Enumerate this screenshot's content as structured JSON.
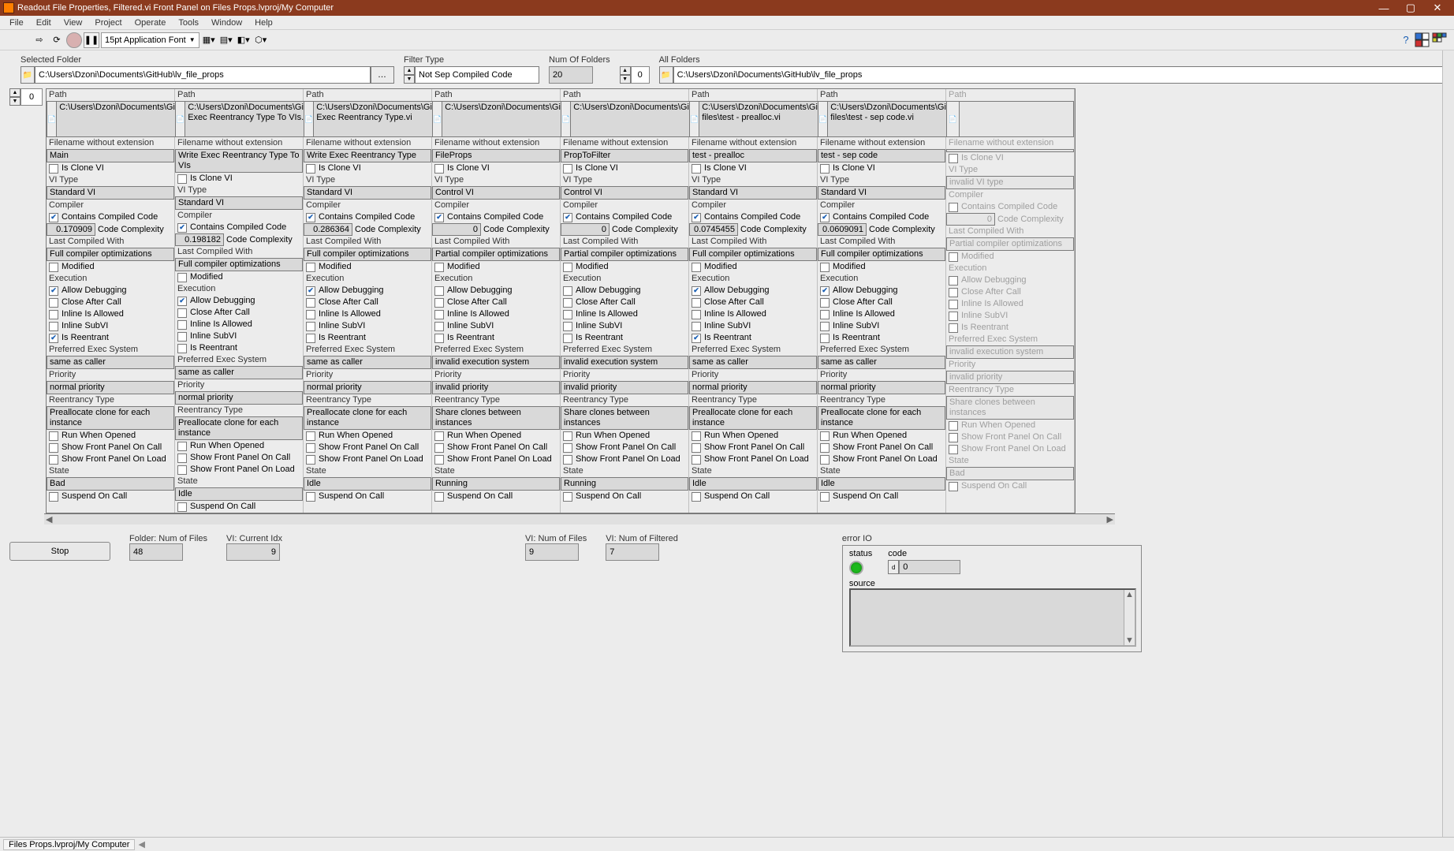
{
  "window": {
    "title": "Readout File Properties, Filtered.vi Front Panel on Files Props.lvproj/My Computer"
  },
  "menu": [
    "File",
    "Edit",
    "View",
    "Project",
    "Operate",
    "Tools",
    "Window",
    "Help"
  ],
  "toolbar": {
    "font": "15pt Application Font"
  },
  "top": {
    "selectedFolder_label": "Selected Folder",
    "selectedFolder": "C:\\Users\\Dzoni\\Documents\\GitHub\\lv_file_props",
    "filterType_label": "Filter Type",
    "filterType": "Not Sep Compiled Code",
    "numFolders_label": "Num Of Folders",
    "numFolders": "20",
    "allFolders_idx": "0",
    "allFolders_label": "All Folders",
    "allFolders": "C:\\Users\\Dzoni\\Documents\\GitHub\\lv_file_props"
  },
  "arrayIndex": "0",
  "labels": {
    "path": "Path",
    "fne": "Filename without extension",
    "isClone": "Is Clone VI",
    "viType": "VI Type",
    "compiler": "Compiler",
    "ccc": "Contains Compiled Code",
    "cc": "Code Complexity",
    "lcw": "Last Compiled With",
    "modified": "Modified",
    "execution": "Execution",
    "allowDebug": "Allow Debugging",
    "closeAfter": "Close After Call",
    "inlineAllowed": "Inline Is Allowed",
    "inlineSub": "Inline SubVI",
    "isReentrant": "Is Reentrant",
    "pes": "Preferred Exec System",
    "priority": "Priority",
    "reentType": "Reentrancy Type",
    "rwo": "Run When Opened",
    "sfpoc": "Show Front Panel On Call",
    "sfpol": "Show Front Panel On Load",
    "state": "State",
    "soc": "Suspend On Call"
  },
  "clusters": [
    {
      "path": "C:\\Users\\Dzoni\\Documents\\GitHub\\lv_file_props\\Main.vi",
      "fne": "Main",
      "isClone": false,
      "viType": "Standard VI",
      "ccc": true,
      "cc": "0.170909",
      "lcw": "Full compiler optimizations",
      "modified": false,
      "allowDebug": true,
      "closeAfter": false,
      "inlineAllowed": false,
      "inlineSub": false,
      "isReentrant": true,
      "pes": "same as caller",
      "priority": "normal priority",
      "reent": "Preallocate clone for each instance",
      "rwo": false,
      "sfpoc": false,
      "sfpol": false,
      "state": "Bad",
      "soc": false
    },
    {
      "path": "C:\\Users\\Dzoni\\Documents\\GitHub\\lv_file_props\\Write Exec Reentrancy Type To VIs.vi",
      "fne": "Write Exec Reentrancy Type To VIs",
      "isClone": false,
      "viType": "Standard VI",
      "ccc": true,
      "cc": "0.198182",
      "lcw": "Full compiler optimizations",
      "modified": false,
      "allowDebug": true,
      "closeAfter": false,
      "inlineAllowed": false,
      "inlineSub": false,
      "isReentrant": false,
      "pes": "same as caller",
      "priority": "normal priority",
      "reent": "Preallocate clone for each instance",
      "rwo": false,
      "sfpoc": false,
      "sfpol": false,
      "state": "Idle",
      "soc": false
    },
    {
      "path": "C:\\Users\\Dzoni\\Documents\\GitHub\\lv_file_props\\Write Exec Reentrancy Type.vi",
      "fne": "Write Exec Reentrancy Type",
      "isClone": false,
      "viType": "Standard VI",
      "ccc": true,
      "cc": "0.286364",
      "lcw": "Full compiler optimizations",
      "modified": false,
      "allowDebug": true,
      "closeAfter": false,
      "inlineAllowed": false,
      "inlineSub": false,
      "isReentrant": false,
      "pes": "same as caller",
      "priority": "normal priority",
      "reent": "Preallocate clone for each instance",
      "rwo": false,
      "sfpoc": false,
      "sfpol": false,
      "state": "Idle",
      "soc": false
    },
    {
      "path": "C:\\Users\\Dzoni\\Documents\\GitHub\\lv_file_props\\TDs\\FileProps.ctl",
      "fne": "FileProps",
      "isClone": false,
      "viType": "Control VI",
      "ccc": true,
      "cc": "0",
      "lcw": "Partial compiler optimizations",
      "modified": false,
      "allowDebug": false,
      "closeAfter": false,
      "inlineAllowed": false,
      "inlineSub": false,
      "isReentrant": false,
      "pes": "invalid execution system",
      "priority": "invalid priority",
      "reent": "Share clones between instances",
      "rwo": false,
      "sfpoc": false,
      "sfpol": false,
      "state": "Running",
      "soc": false
    },
    {
      "path": "C:\\Users\\Dzoni\\Documents\\GitHub\\lv_file_props\\TDs\\PropToFilter.ctl",
      "fne": "PropToFilter",
      "isClone": false,
      "viType": "Control VI",
      "ccc": true,
      "cc": "0",
      "lcw": "Partial compiler optimizations",
      "modified": false,
      "allowDebug": false,
      "closeAfter": false,
      "inlineAllowed": false,
      "inlineSub": false,
      "isReentrant": false,
      "pes": "invalid execution system",
      "priority": "invalid priority",
      "reent": "Share clones between instances",
      "rwo": false,
      "sfpoc": false,
      "sfpol": false,
      "state": "Running",
      "soc": false
    },
    {
      "path": "C:\\Users\\Dzoni\\Documents\\GitHub\\lv_file_props\\test files\\test - prealloc.vi",
      "fne": "test - prealloc",
      "isClone": false,
      "viType": "Standard VI",
      "ccc": true,
      "cc": "0.0745455",
      "lcw": "Full compiler optimizations",
      "modified": false,
      "allowDebug": true,
      "closeAfter": false,
      "inlineAllowed": false,
      "inlineSub": false,
      "isReentrant": true,
      "pes": "same as caller",
      "priority": "normal priority",
      "reent": "Preallocate clone for each instance",
      "rwo": false,
      "sfpoc": false,
      "sfpol": false,
      "state": "Idle",
      "soc": false
    },
    {
      "path": "C:\\Users\\Dzoni\\Documents\\GitHub\\lv_file_props\\test files\\test - sep code.vi",
      "fne": "test - sep code",
      "isClone": false,
      "viType": "Standard VI",
      "ccc": true,
      "cc": "0.0609091",
      "lcw": "Full compiler optimizations",
      "modified": false,
      "allowDebug": true,
      "closeAfter": false,
      "inlineAllowed": false,
      "inlineSub": false,
      "isReentrant": false,
      "pes": "same as caller",
      "priority": "normal priority",
      "reent": "Preallocate clone for each instance",
      "rwo": false,
      "sfpoc": false,
      "sfpol": false,
      "state": "Idle",
      "soc": false
    },
    {
      "path": "",
      "fne": "",
      "isClone": false,
      "viType": "invalid VI type",
      "ccc": false,
      "cc": "0",
      "lcw": "Partial compiler optimizations",
      "modified": false,
      "allowDebug": false,
      "closeAfter": false,
      "inlineAllowed": false,
      "inlineSub": false,
      "isReentrant": false,
      "pes": "invalid execution system",
      "priority": "invalid priority",
      "reent": "Share clones between instances",
      "rwo": false,
      "sfpoc": false,
      "sfpol": false,
      "state": "Bad",
      "soc": false,
      "disabled": true
    }
  ],
  "bottom": {
    "stop": "Stop",
    "folderNum_label": "Folder: Num of Files",
    "folderNum": "48",
    "curIdx_label": "VI: Current Idx",
    "curIdx": "9",
    "viNum_label": "VI: Num of Files",
    "viNum": "9",
    "viFilt_label": "VI: Num of Filtered",
    "viFilt": "7"
  },
  "error": {
    "title": "error IO",
    "status_label": "status",
    "code_label": "code",
    "code": "0",
    "source_label": "source"
  },
  "statusbar": "Files Props.lvproj/My Computer"
}
